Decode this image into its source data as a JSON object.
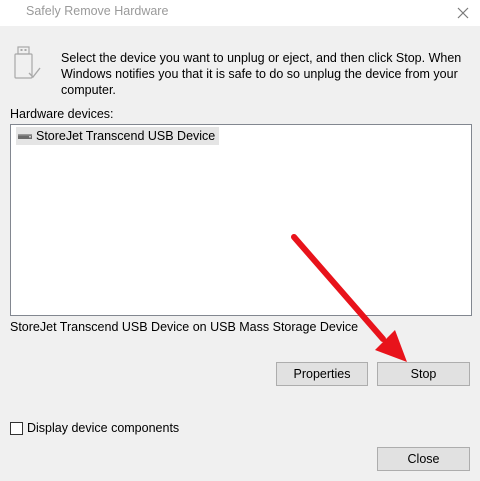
{
  "window": {
    "title": "Safely Remove Hardware",
    "close_icon": "close-icon"
  },
  "header": {
    "icon": "usb-drive-icon",
    "instructions": "Select the device you want to unplug or eject, and then click Stop. When Windows notifies you that it is safe to do so unplug the device from your computer."
  },
  "devices": {
    "label": "Hardware devices:",
    "items": [
      {
        "name": "StoreJet Transcend USB Device",
        "icon": "drive-icon",
        "selected": true
      }
    ],
    "description": "StoreJet Transcend USB Device on USB Mass Storage Device"
  },
  "buttons": {
    "properties": "Properties",
    "stop": "Stop",
    "close": "Close"
  },
  "options": {
    "display_components_label": "Display device components",
    "display_components_checked": false
  },
  "annotation": {
    "arrow_color": "#e8131b",
    "arrow_target": "stop-button"
  }
}
